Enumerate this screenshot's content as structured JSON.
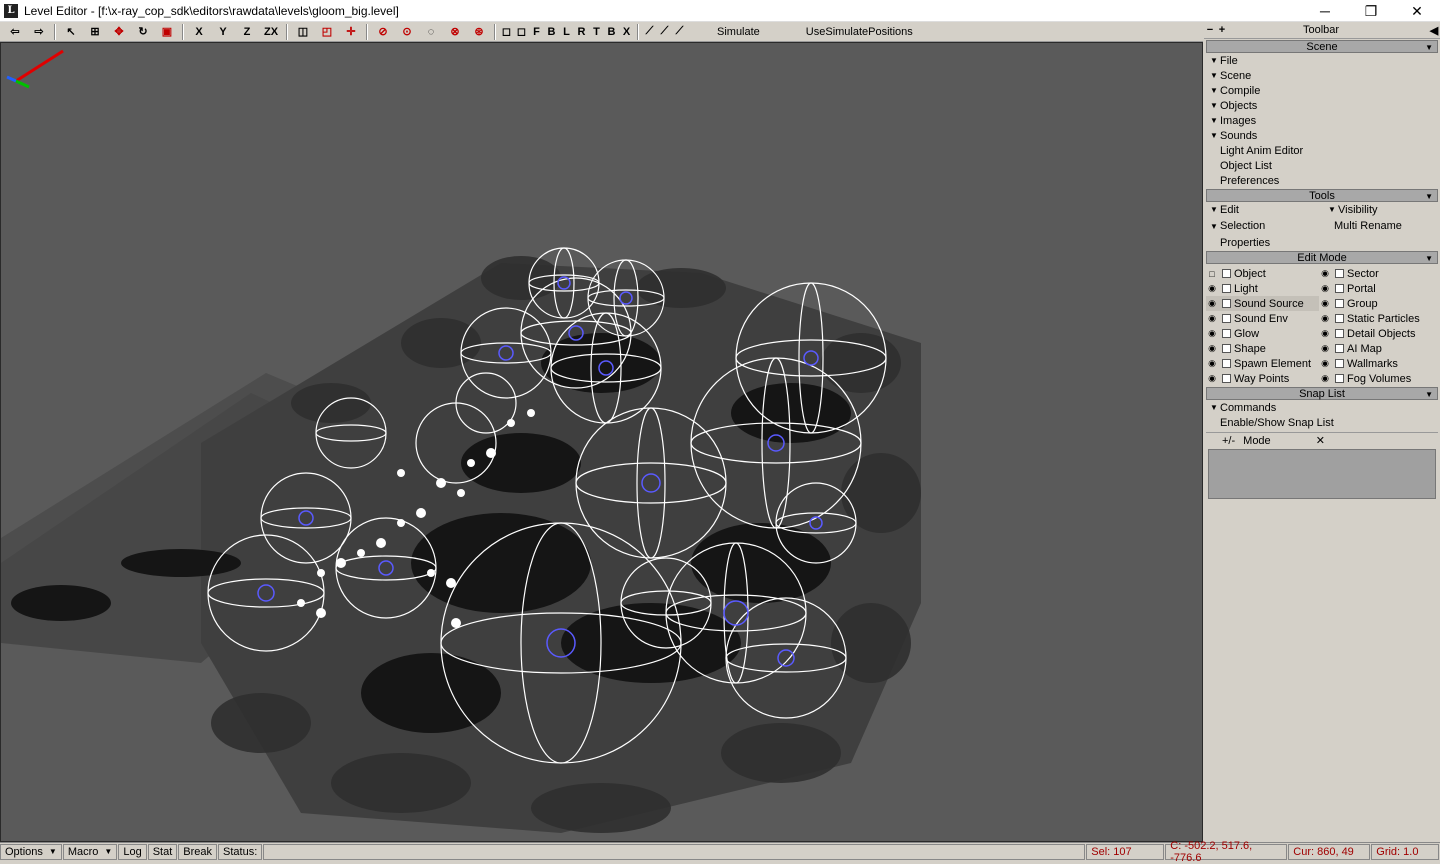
{
  "window": {
    "icon_letter": "L",
    "title": "Level Editor - [f:\\x-ray_cop_sdk\\editors\\rawdata\\levels\\gloom_big.level]",
    "minimize": "─",
    "maximize": "❐",
    "close": "✕"
  },
  "toolbar": {
    "axis_x": "X",
    "axis_y": "Y",
    "axis_z": "Z",
    "axis_zx": "ZX",
    "view_f": "F",
    "view_b": "B",
    "view_l": "L",
    "view_r": "R",
    "view_t": "T",
    "view_b2": "B",
    "view_x": "X",
    "simulate": "Simulate",
    "use_simulate": "UseSimulatePositions"
  },
  "panel": {
    "header": "Toolbar",
    "scene": {
      "title": "Scene",
      "items": [
        "File",
        "Scene",
        "Compile",
        "Objects",
        "Images",
        "Sounds"
      ],
      "plain_items": [
        "Light Anim Editor",
        "Object List",
        "Preferences"
      ]
    },
    "tools": {
      "title": "Tools",
      "edit": "Edit",
      "visibility": "Visibility",
      "selection": "Selection",
      "multi_rename": "Multi Rename",
      "properties": "Properties"
    },
    "edit_mode": {
      "title": "Edit Mode",
      "left": [
        "Object",
        "Light",
        "Sound Source",
        "Sound Env",
        "Glow",
        "Shape",
        "Spawn Element",
        "Way Points"
      ],
      "right": [
        "Sector",
        "Portal",
        "Group",
        "Static Particles",
        "Detail Objects",
        "AI Map",
        "Wallmarks",
        "Fog Volumes"
      ]
    },
    "snap_list": {
      "title": "Snap List",
      "commands": "Commands",
      "enable_show": "Enable/Show Snap List",
      "mode_prefix": "+/-",
      "mode": "Mode",
      "close": "✕"
    }
  },
  "status": {
    "options": "Options",
    "macro": "Macro",
    "log": "Log",
    "stat": "Stat",
    "break": "Break",
    "status_label": "Status:",
    "sel": "Sel: 107",
    "coords": "C: -502.2, 517.6, -776.6",
    "cur": "Cur: 860, 49",
    "grid": "Grid: 1.0"
  }
}
